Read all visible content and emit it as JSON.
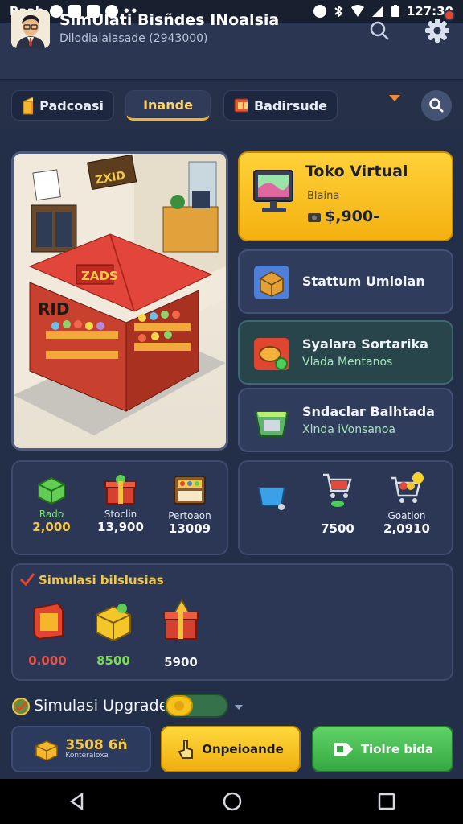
{
  "status_bar": {
    "carrier": "Raab",
    "time": "127:30"
  },
  "header": {
    "title": "SimUlati Bisñdes INoalsia",
    "subtitle": "Dilodialaiasade (2943000)"
  },
  "tabs": [
    {
      "label": "Padcoasi",
      "icon": "box-icon"
    },
    {
      "label": "Inande",
      "icon": ""
    },
    {
      "label": "Badirsude",
      "icon": "grid-icon"
    }
  ],
  "scene": {
    "banner_top": "ZXID",
    "banner_roof": "ZADS",
    "banner_side": "RID"
  },
  "toko": {
    "title": "Toko Virtual",
    "subtitle": "Blaina",
    "price": "$,900-"
  },
  "cards": [
    {
      "title": "Stattum Umlolan",
      "subtitle": ""
    },
    {
      "title": "Syalara Sortarika",
      "subtitle": "Vlada Mentanos"
    },
    {
      "title": "Sndaclar Balhtada",
      "subtitle": "Xlnda iVonsanoa"
    }
  ],
  "stats_left": [
    {
      "label": "Rado",
      "value": "2,000"
    },
    {
      "label": "Stoclin",
      "value": "13,900"
    },
    {
      "label": "Pertoaon",
      "value": "13009"
    }
  ],
  "stats_right": [
    {
      "label": "",
      "value": ""
    },
    {
      "label": "",
      "value": "7500"
    },
    {
      "label": "Goation",
      "value": "2,0910"
    }
  ],
  "simulasi": {
    "title": "Simulasi bilslusias",
    "items": [
      {
        "value": "0.000",
        "color": "#e0574a"
      },
      {
        "value": "8500",
        "color": "#7ed957"
      },
      {
        "value": "5900",
        "color": "#f4f6fb"
      }
    ]
  },
  "upgrade": {
    "label": "Simulasi Upgrade",
    "toggle_on": true
  },
  "buttons": {
    "price": "3508  6ñ",
    "price_sub": "Konteraloxa",
    "upgrade": "Onpeioande",
    "store": "Tiolre bida"
  }
}
